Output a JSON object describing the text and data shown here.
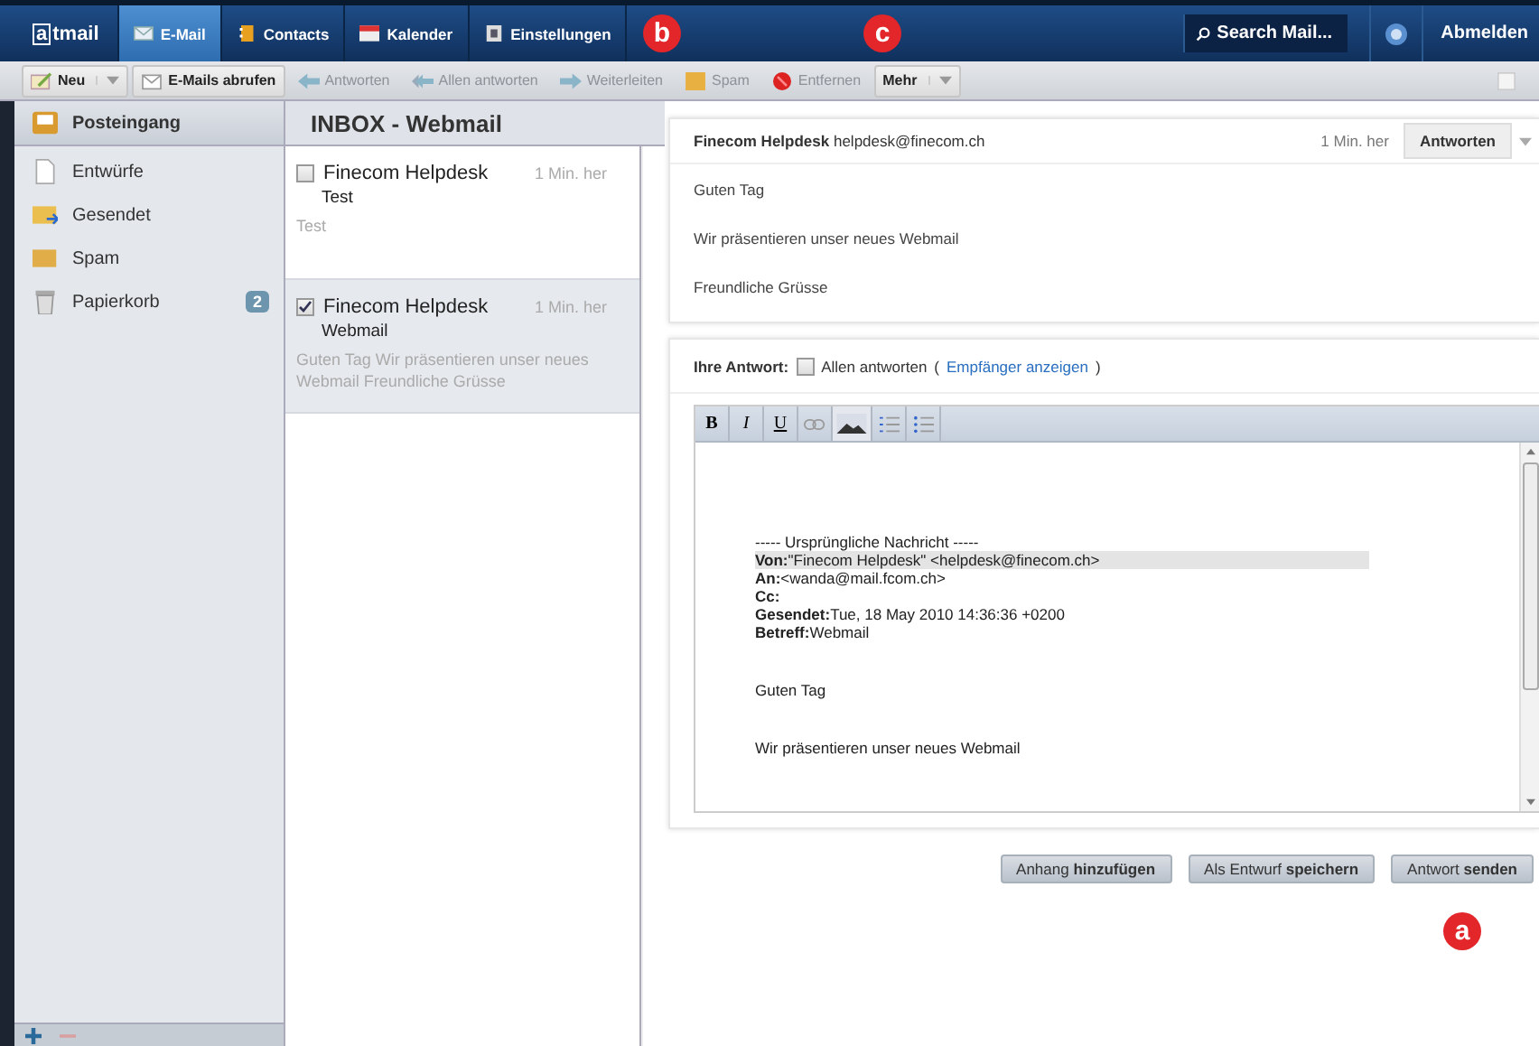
{
  "nav": {
    "logo_mark": "a",
    "logo_rest": "tmail",
    "tabs": [
      {
        "label": "E-Mail",
        "selected": true
      },
      {
        "label": "Contacts",
        "selected": false
      },
      {
        "label": "Kalender",
        "selected": false
      },
      {
        "label": "Einstellungen",
        "selected": false
      }
    ],
    "search": {
      "placeholder": "Search Mail..."
    },
    "logout": "Abmelden"
  },
  "toolbar": [
    {
      "label": "Neu",
      "disabled": false,
      "dropdown": true
    },
    {
      "label": "E-Mails abrufen",
      "disabled": false,
      "dropdown": false
    },
    {
      "label": "Antworten",
      "disabled": true,
      "dropdown": false
    },
    {
      "label": "Allen antworten",
      "disabled": true,
      "dropdown": false
    },
    {
      "label": "Weiterleiten",
      "disabled": true,
      "dropdown": false
    },
    {
      "label": "Spam",
      "disabled": true,
      "dropdown": false
    },
    {
      "label": "Entfernen",
      "disabled": true,
      "dropdown": false
    },
    {
      "label": "Mehr",
      "disabled": false,
      "dropdown": true
    }
  ],
  "callouts": [
    "b",
    "c",
    "a"
  ],
  "folders": [
    {
      "label": "Posteingang",
      "selected": true
    },
    {
      "label": "Entwürfe",
      "selected": false
    },
    {
      "label": "Gesendet",
      "selected": false
    },
    {
      "label": "Spam",
      "selected": false
    },
    {
      "label": "Papierkorb",
      "selected": false,
      "count": "2"
    }
  ],
  "list_title": "INBOX - Webmail",
  "messages": [
    {
      "sender": "Finecom Helpdesk",
      "time": "1 Min. her",
      "subject": "Test",
      "preview": "Test",
      "checked": false,
      "selected": false
    },
    {
      "sender": "Finecom Helpdesk",
      "time": "1 Min. her",
      "subject": "Webmail",
      "preview": "Guten Tag Wir präsentieren unser neues Webmail Freundliche Grüsse",
      "checked": true,
      "selected": true
    }
  ],
  "message": {
    "from": "**Finecom Helpdesk** helpdesk@finecom.ch",
    "time": "1 Min. her",
    "reply_button": "Antworten",
    "body": [
      "Guten Tag",
      "Wir präsentieren unser neues Webmail",
      "Freundliche Grüsse"
    ]
  },
  "reply": {
    "label": "Ihre Antwort:",
    "reply_all": {
      "label": "Allen antworten",
      "checked": false
    },
    "paren_open": "(",
    "link": "Empfänger anzeigen",
    "paren_close": ")",
    "format_buttons": [
      {
        "label": "B",
        "kind": "bold"
      },
      {
        "label": "I",
        "kind": "italic"
      },
      {
        "label": "U",
        "kind": "underline"
      },
      {
        "kind": "link"
      },
      {
        "kind": "image"
      },
      {
        "kind": "ordered"
      },
      {
        "kind": "bullets"
      }
    ],
    "lines": [
      {
        "text": "----- Ursprüngliche Nachricht -----",
        "highlighted": false
      },
      {
        "text": "**Von:**\"Finecom Helpdesk\" <helpdesk@finecom.ch>",
        "highlighted": true
      },
      {
        "text": "**An:**<wanda@mail.fcom.ch>",
        "highlighted": false
      },
      {
        "text": "**Cc:**",
        "highlighted": false
      },
      {
        "text": "**Gesendet:**Tue, 18 May 2010 14:36:36 +0200",
        "highlighted": false
      },
      {
        "text": "**Betreff:**Webmail",
        "highlighted": false
      }
    ],
    "paragraphs": [
      "Guten Tag",
      "Wir präsentieren unser neues Webmail"
    ]
  },
  "actions": [
    "Anhang **hinzufügen**",
    "Als Entwurf **speichern**",
    "Antwort **senden**"
  ]
}
